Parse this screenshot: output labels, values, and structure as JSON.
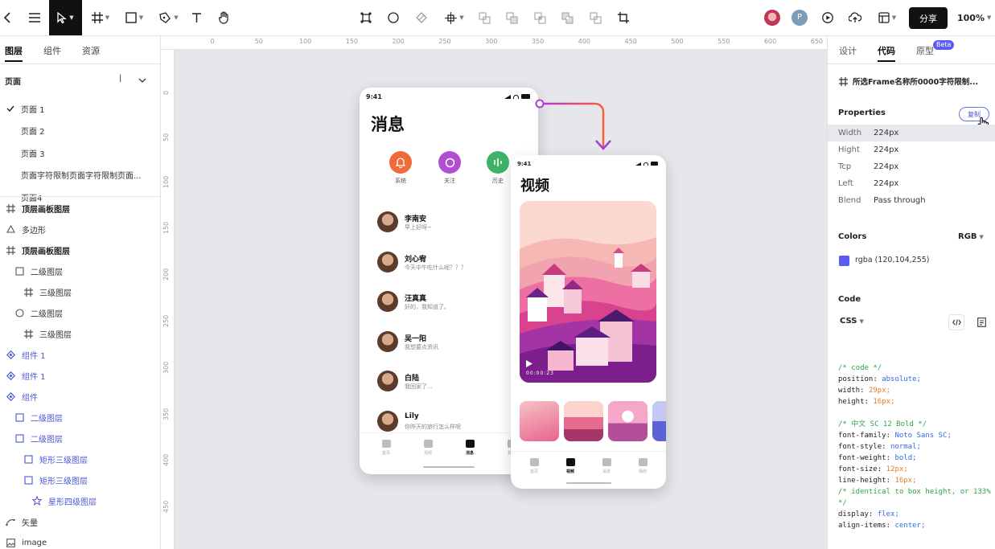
{
  "toolbar": {
    "share_label": "分享",
    "zoom_label": "100%"
  },
  "left_panel": {
    "tabs": [
      "图层",
      "组件",
      "资源"
    ],
    "pages_title": "页面",
    "pages_separator": "|",
    "pages": [
      {
        "label": "页面 1",
        "checked": true
      },
      {
        "label": "页面 2",
        "checked": false
      },
      {
        "label": "页面 3",
        "checked": false
      },
      {
        "label": "页面字符限制页面字符限制页面...",
        "checked": false
      },
      {
        "label": "页面4",
        "checked": false
      }
    ],
    "layers": [
      {
        "label": "顶层画板图层",
        "icon": "frame-icon",
        "indent": 0,
        "style": "bold"
      },
      {
        "label": "多边形",
        "icon": "triangle-icon",
        "indent": 0,
        "style": "normal"
      },
      {
        "label": "顶层画板图层",
        "icon": "frame-icon",
        "indent": 0,
        "style": "bold"
      },
      {
        "label": "二级图层",
        "icon": "rectangle-icon",
        "indent": 1,
        "style": "normal"
      },
      {
        "label": "三级图层",
        "icon": "frame-icon",
        "indent": 2,
        "style": "normal"
      },
      {
        "label": "二级图层",
        "icon": "circle-icon",
        "indent": 1,
        "style": "normal"
      },
      {
        "label": "三级图层",
        "icon": "frame-icon",
        "indent": 2,
        "style": "normal"
      },
      {
        "label": "组件 1",
        "icon": "component-icon",
        "indent": 0,
        "style": "comp"
      },
      {
        "label": "组件 1",
        "icon": "component-icon",
        "indent": 0,
        "style": "comp"
      },
      {
        "label": "组件",
        "icon": "component-icon",
        "indent": 0,
        "style": "comp"
      },
      {
        "label": "二级图层",
        "icon": "rectangle-icon",
        "indent": 1,
        "style": "comp"
      },
      {
        "label": "二级图层",
        "icon": "rectangle-icon",
        "indent": 1,
        "style": "comp"
      },
      {
        "label": "矩形三级图层",
        "icon": "rectangle-icon",
        "indent": 2,
        "style": "comp"
      },
      {
        "label": "矩形三级图层",
        "icon": "rectangle-icon",
        "indent": 2,
        "style": "comp"
      },
      {
        "label": "星形四级图层",
        "icon": "star-icon",
        "indent": 3,
        "style": "comp"
      },
      {
        "label": "矢量",
        "icon": "vector-icon",
        "indent": 0,
        "style": "normal"
      },
      {
        "label": "image",
        "icon": "image-icon",
        "indent": 0,
        "style": "normal"
      }
    ]
  },
  "ruler": {
    "top_ticks": [
      "0",
      "50",
      "100",
      "150",
      "200",
      "250",
      "300",
      "350",
      "400",
      "450",
      "500",
      "550",
      "600",
      "650"
    ],
    "left_ticks": [
      "0",
      "50",
      "100",
      "150",
      "200",
      "250",
      "300",
      "350",
      "400",
      "450"
    ]
  },
  "canvas": {
    "phone_messages": {
      "time": "9:41",
      "title": "消息",
      "shortcuts": [
        {
          "label": "系统",
          "color": "#f06a3c"
        },
        {
          "label": "关注",
          "color": "#b04fd0"
        },
        {
          "label": "历史",
          "color": "#3fb26a"
        }
      ],
      "contacts": [
        {
          "name": "李南安",
          "message": "早上好呀~"
        },
        {
          "name": "刘心宥",
          "message": "今天中午吃什么呢？？？"
        },
        {
          "name": "汪真真",
          "message": "好的，我知道了。"
        },
        {
          "name": "吴一阳",
          "message": "我想要点资讯"
        },
        {
          "name": "白陆",
          "message": "我回家了..."
        },
        {
          "name": "Lily",
          "message": "你昨天的旅行怎么样呢"
        }
      ],
      "tabbar": [
        {
          "label": "首页",
          "active": false
        },
        {
          "label": "视频",
          "active": false
        },
        {
          "label": "消息",
          "active": true
        },
        {
          "label": "我的",
          "active": false
        }
      ]
    },
    "phone_video": {
      "time": "9:41",
      "title": "视频",
      "video_time": "00:00:23",
      "tabbar": [
        {
          "label": "首页",
          "active": false
        },
        {
          "label": "视频",
          "active": true
        },
        {
          "label": "消息",
          "active": false
        },
        {
          "label": "我的",
          "active": false
        }
      ]
    }
  },
  "right_panel": {
    "tabs": [
      "设计",
      "代码",
      "原型"
    ],
    "beta_label": "Beta",
    "frame_name": "所选Frame名称所0000字符限制...",
    "properties_title": "Properties",
    "copy_label": "复制",
    "properties": [
      {
        "key": "Width",
        "value": "224px"
      },
      {
        "key": "Hight",
        "value": "224px"
      },
      {
        "key": "Tcp",
        "value": "224px"
      },
      {
        "key": "Left",
        "value": "224px"
      },
      {
        "key": "Blend",
        "value": "Pass through"
      }
    ],
    "colors_title": "Colors",
    "color_mode": "RGB",
    "color_value": "rgba (120,104,255)",
    "swatch_color": "#5a5af2",
    "code_title": "Code",
    "code_lang": "CSS",
    "code_lines": [
      {
        "key": "",
        "value": "/* code */",
        "kind": "comment"
      },
      {
        "key": "position: ",
        "value": "absolute;",
        "kind": "kw"
      },
      {
        "key": "width: ",
        "value": "29px;",
        "kind": "num"
      },
      {
        "key": "height: ",
        "value": "16px;",
        "kind": "num"
      },
      {
        "key": "",
        "value": "",
        "kind": "blank"
      },
      {
        "key": "",
        "value": "/* 中文 SC 12 Bold */",
        "kind": "comment"
      },
      {
        "key": "font-family: ",
        "value": "Noto Sans SC;",
        "kind": "kw"
      },
      {
        "key": "font-style: ",
        "value": "normal;",
        "kind": "kw"
      },
      {
        "key": "font-weight: ",
        "value": "bold;",
        "kind": "kw"
      },
      {
        "key": "font-size: ",
        "value": "12px;",
        "kind": "num"
      },
      {
        "key": "line-height: ",
        "value": "16px;",
        "kind": "num"
      },
      {
        "key": "",
        "value": "/* identical to box height, or 133% */",
        "kind": "comment"
      },
      {
        "key": "display: ",
        "value": "flex;",
        "kind": "kw"
      },
      {
        "key": "align-items: ",
        "value": "center;",
        "kind": "kw"
      }
    ]
  }
}
